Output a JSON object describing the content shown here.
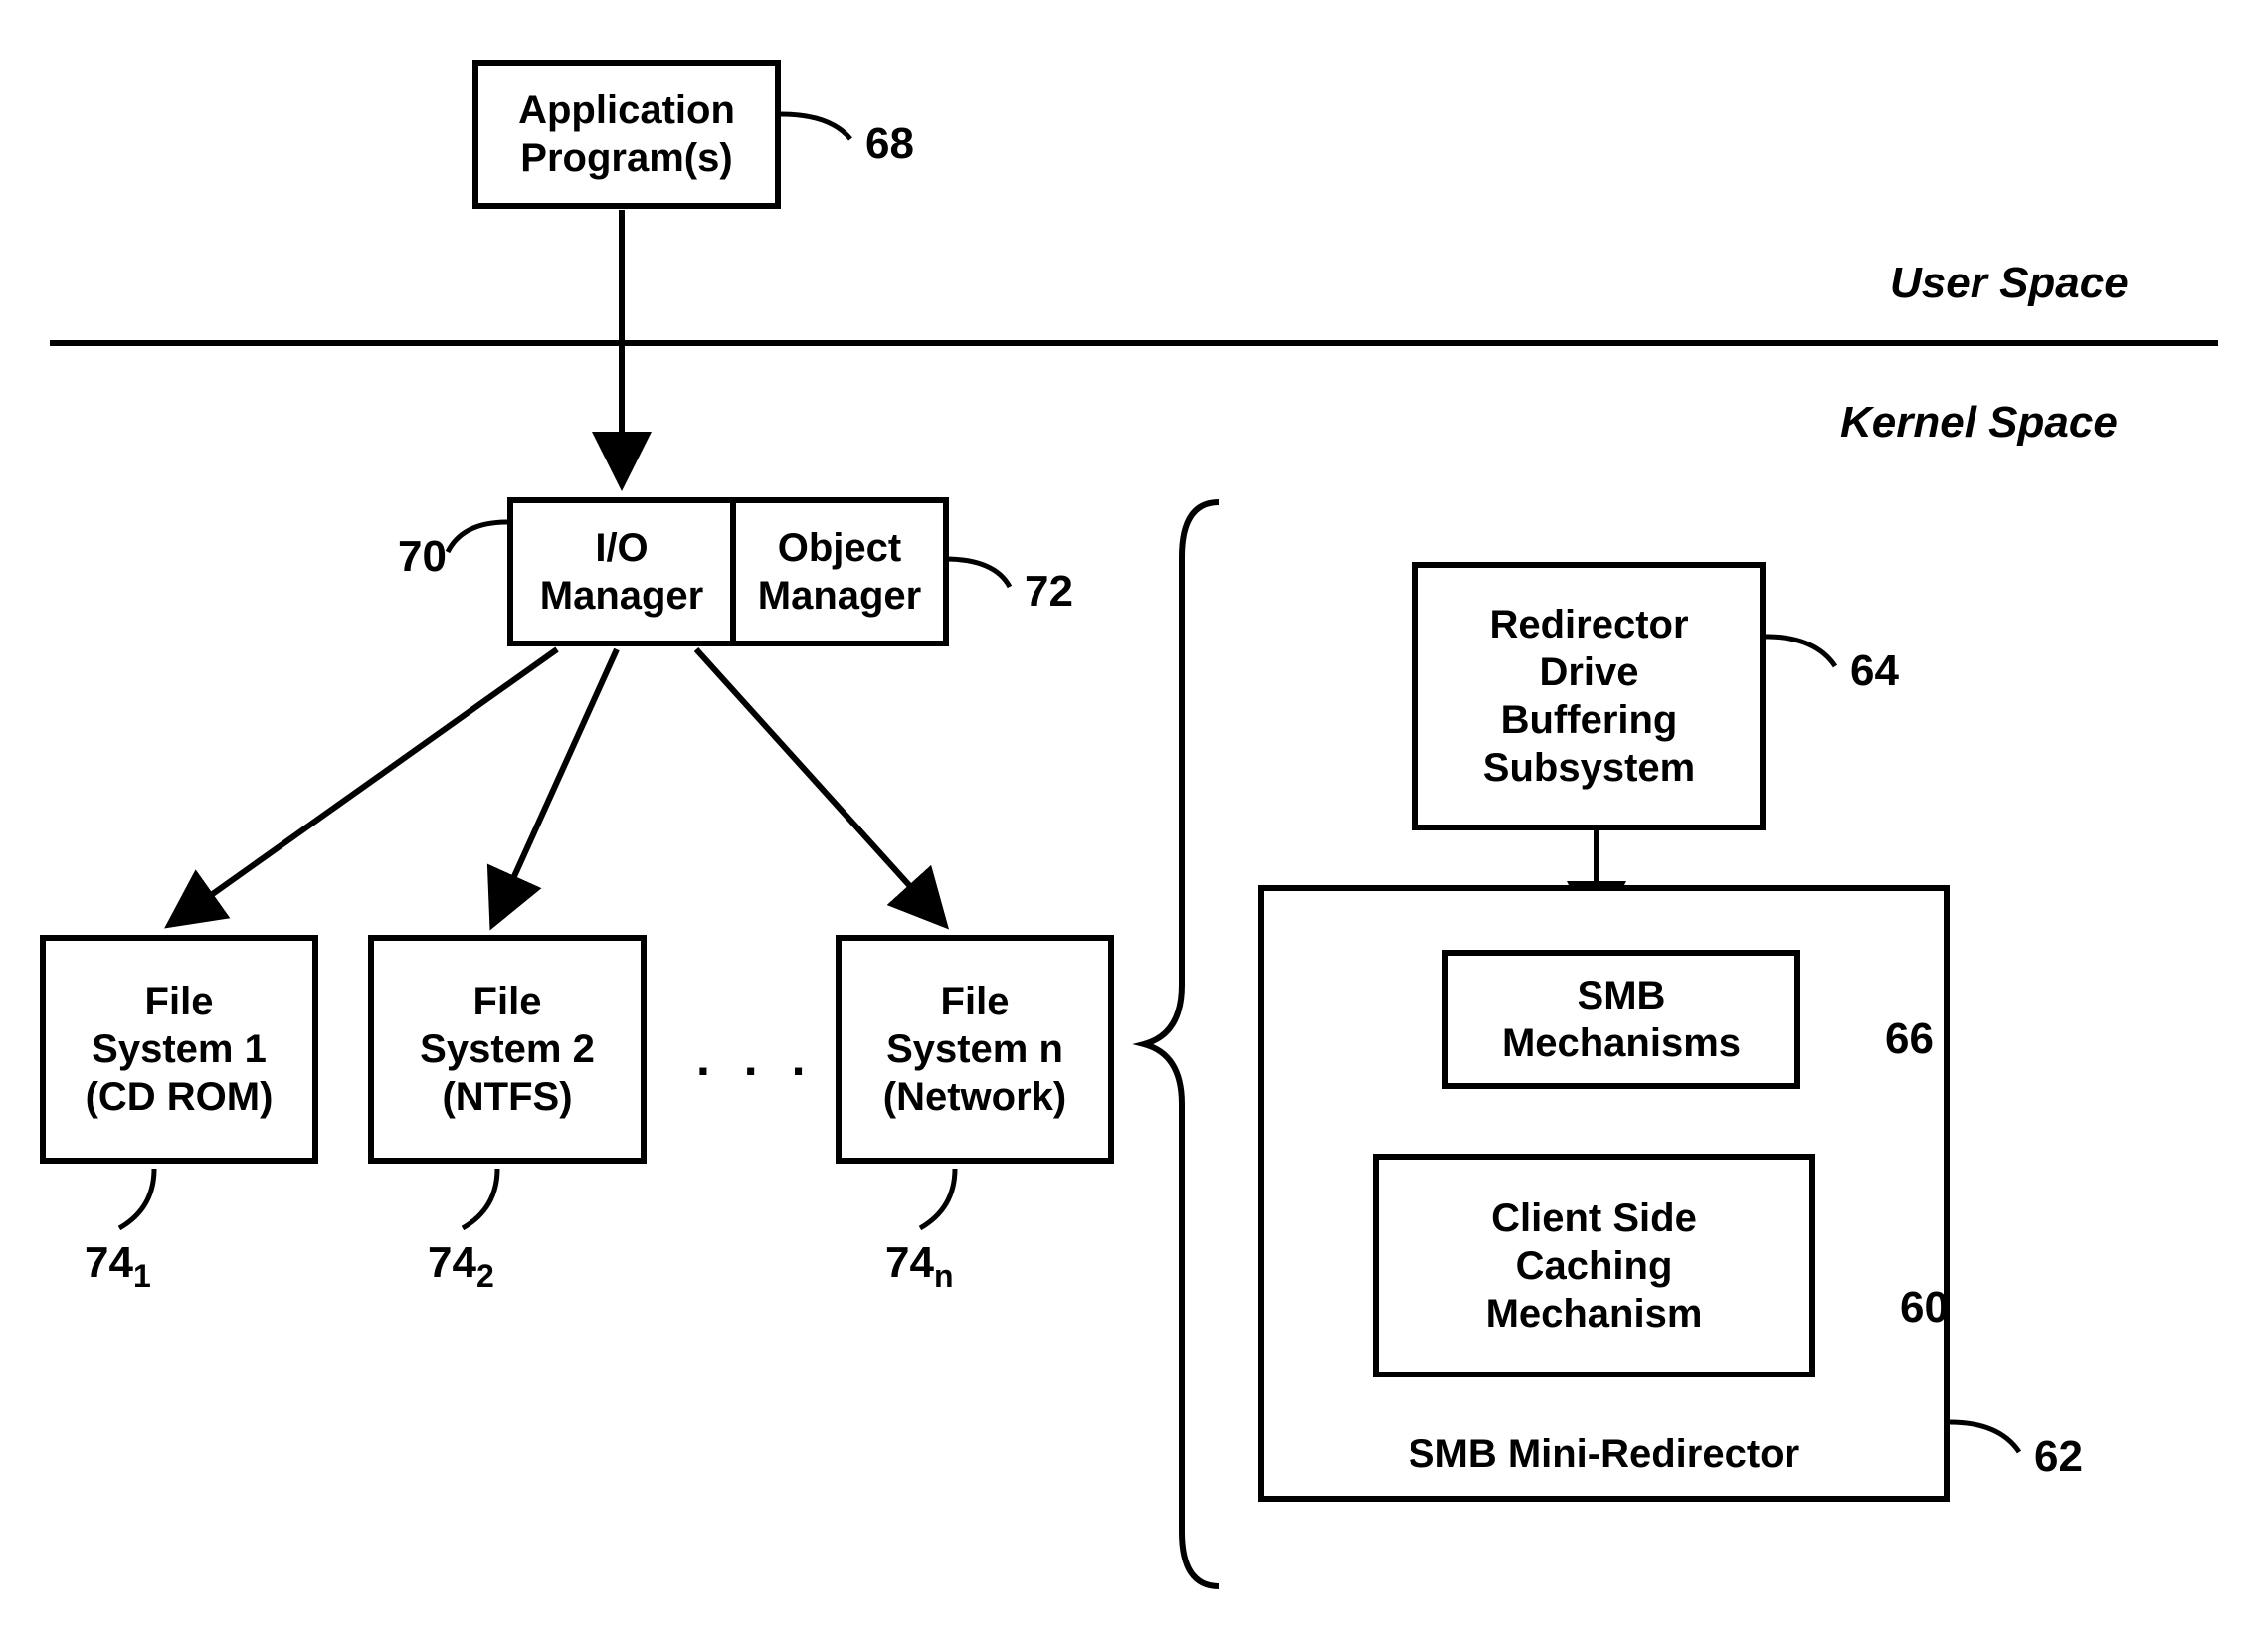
{
  "spaces": {
    "user": "User Space",
    "kernel": "Kernel Space"
  },
  "nodes": {
    "app": {
      "line1": "Application",
      "line2": "Program(s)",
      "ref": "68"
    },
    "io_manager": {
      "line1": "I/O",
      "line2": "Manager",
      "ref": "70"
    },
    "object_manager": {
      "line1": "Object",
      "line2": "Manager",
      "ref": "72"
    },
    "fs1": {
      "line1": "File",
      "line2": "System 1",
      "line3": "(CD ROM)",
      "ref_base": "74",
      "ref_sub": "1"
    },
    "fs2": {
      "line1": "File",
      "line2": "System 2",
      "line3": "(NTFS)",
      "ref_base": "74",
      "ref_sub": "2"
    },
    "fsn": {
      "line1": "File",
      "line2": "System n",
      "line3": "(Network)",
      "ref_base": "74",
      "ref_sub": "n"
    },
    "redirector": {
      "line1": "Redirector",
      "line2": "Drive",
      "line3": "Buffering",
      "line4": "Subsystem",
      "ref": "64"
    },
    "smb_mech": {
      "line1": "SMB",
      "line2": "Mechanisms",
      "ref": "66"
    },
    "csc": {
      "line1": "Client Side",
      "line2": "Caching",
      "line3": "Mechanism",
      "ref": "60"
    },
    "smb_mini": {
      "label": "SMB Mini-Redirector",
      "ref": "62"
    }
  },
  "misc": {
    "dots": ". . . ."
  }
}
